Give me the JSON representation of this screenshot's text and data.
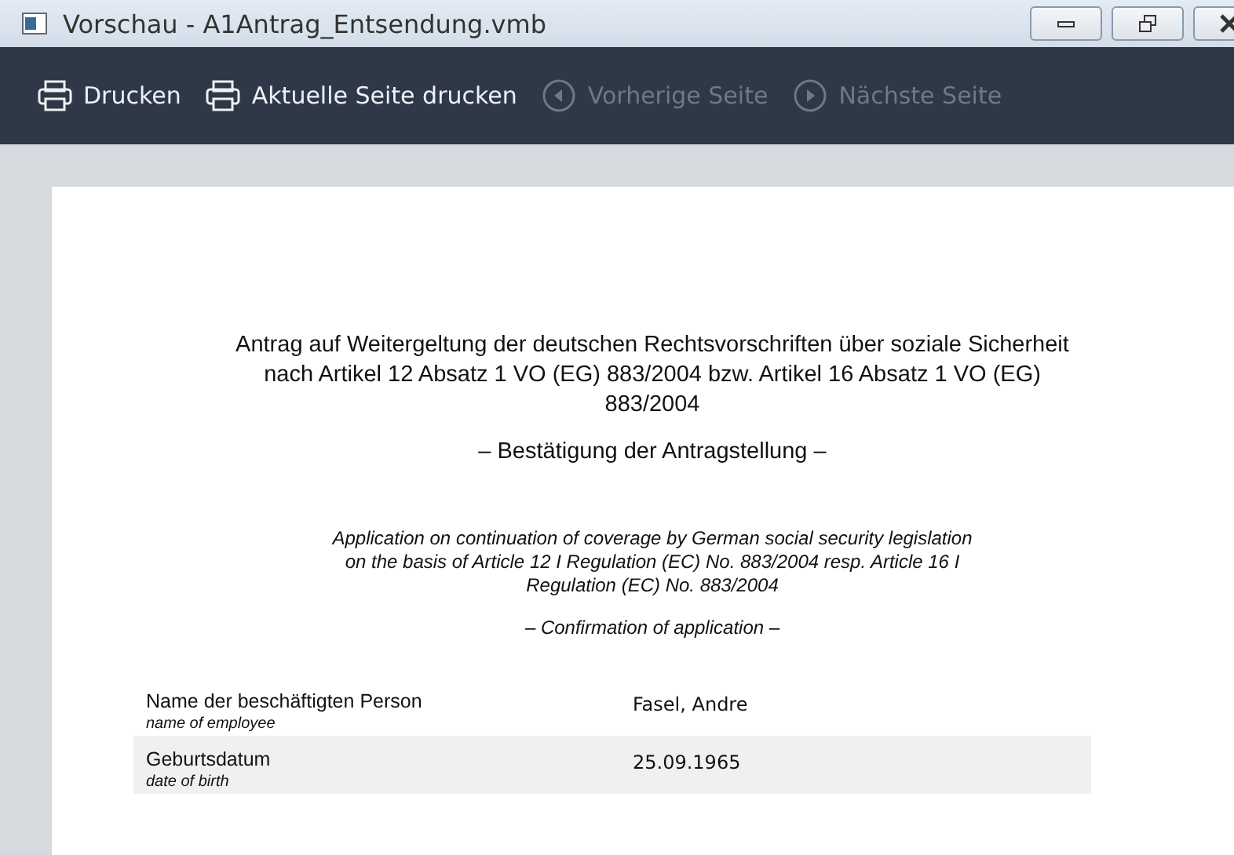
{
  "window": {
    "title": "Vorschau - A1Antrag_Entsendung.vmb"
  },
  "toolbar": [
    {
      "kind": "print",
      "label": "Drucken",
      "disabled": false
    },
    {
      "kind": "print",
      "label": "Aktuelle Seite drucken",
      "disabled": false
    },
    {
      "kind": "prev",
      "label": "Vorherige Seite",
      "disabled": true
    },
    {
      "kind": "next",
      "label": "Nächste Seite",
      "disabled": true
    }
  ],
  "document": {
    "heading_de": "Antrag auf Weitergeltung der deutschen Rechtsvorschriften über soziale Sicherheit nach Artikel 12 Absatz 1 VO (EG) 883/2004 bzw. Artikel 16 Absatz 1 VO (EG) 883/2004",
    "subheading_de": "– Bestätigung der Antragstellung –",
    "heading_en": "Application on continuation of coverage by German social security legislation on the basis of Article 12 I Regulation (EC) No. 883/2004 resp. Article 16 I Regulation (EC) No. 883/2004",
    "subheading_en": "– Confirmation of application –",
    "rows": [
      {
        "label": "Name der beschäftigten Person",
        "label_en": "name of employee",
        "value": "Fasel, Andre"
      },
      {
        "label": "Geburtsdatum",
        "label_en": "date of birth",
        "value": "25.09.1965"
      }
    ]
  }
}
